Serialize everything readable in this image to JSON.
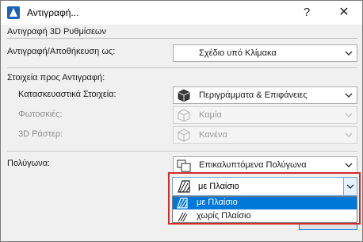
{
  "window": {
    "title": "Αντιγραφή...",
    "help_label": "?",
    "close_label": "✕"
  },
  "section_3d": {
    "heading": "Αντιγραφή 3D Ρυθμίσεων",
    "save_as_label": "Αντιγραφή/Αποθήκευση ως:",
    "save_as_value": "Σχέδιο υπό Κλίμακα"
  },
  "section_elements": {
    "heading": "Στοιχεία προς Αντιγραφή:",
    "construction_label": "Κατασκευαστικά Στοιχεία:",
    "construction_value": "Περιγράμματα & Επιφάνειες",
    "construction_icon": "cube-icon",
    "lights_label": "Φωτοσκιές:",
    "lights_value": "Καμία",
    "lights_icon": "cube-outline-icon",
    "raster_label": "3D Ράστερ:",
    "raster_value": "Κανένα",
    "raster_icon": "cube-outline-icon"
  },
  "section_polygons": {
    "label": "Πολύγωνα:",
    "value": "Επικαλυπτόμενα Πολύγωνα",
    "icon": "overlapping-polygons-icon",
    "frame_select_value": "με Πλαίσιο",
    "options": [
      {
        "label": "με Πλαίσιο",
        "selected": true
      },
      {
        "label": "χωρίς Πλαίσιο",
        "selected": false
      }
    ]
  },
  "colors": {
    "highlight": "#d42b2b",
    "selection": "#0078d7"
  }
}
